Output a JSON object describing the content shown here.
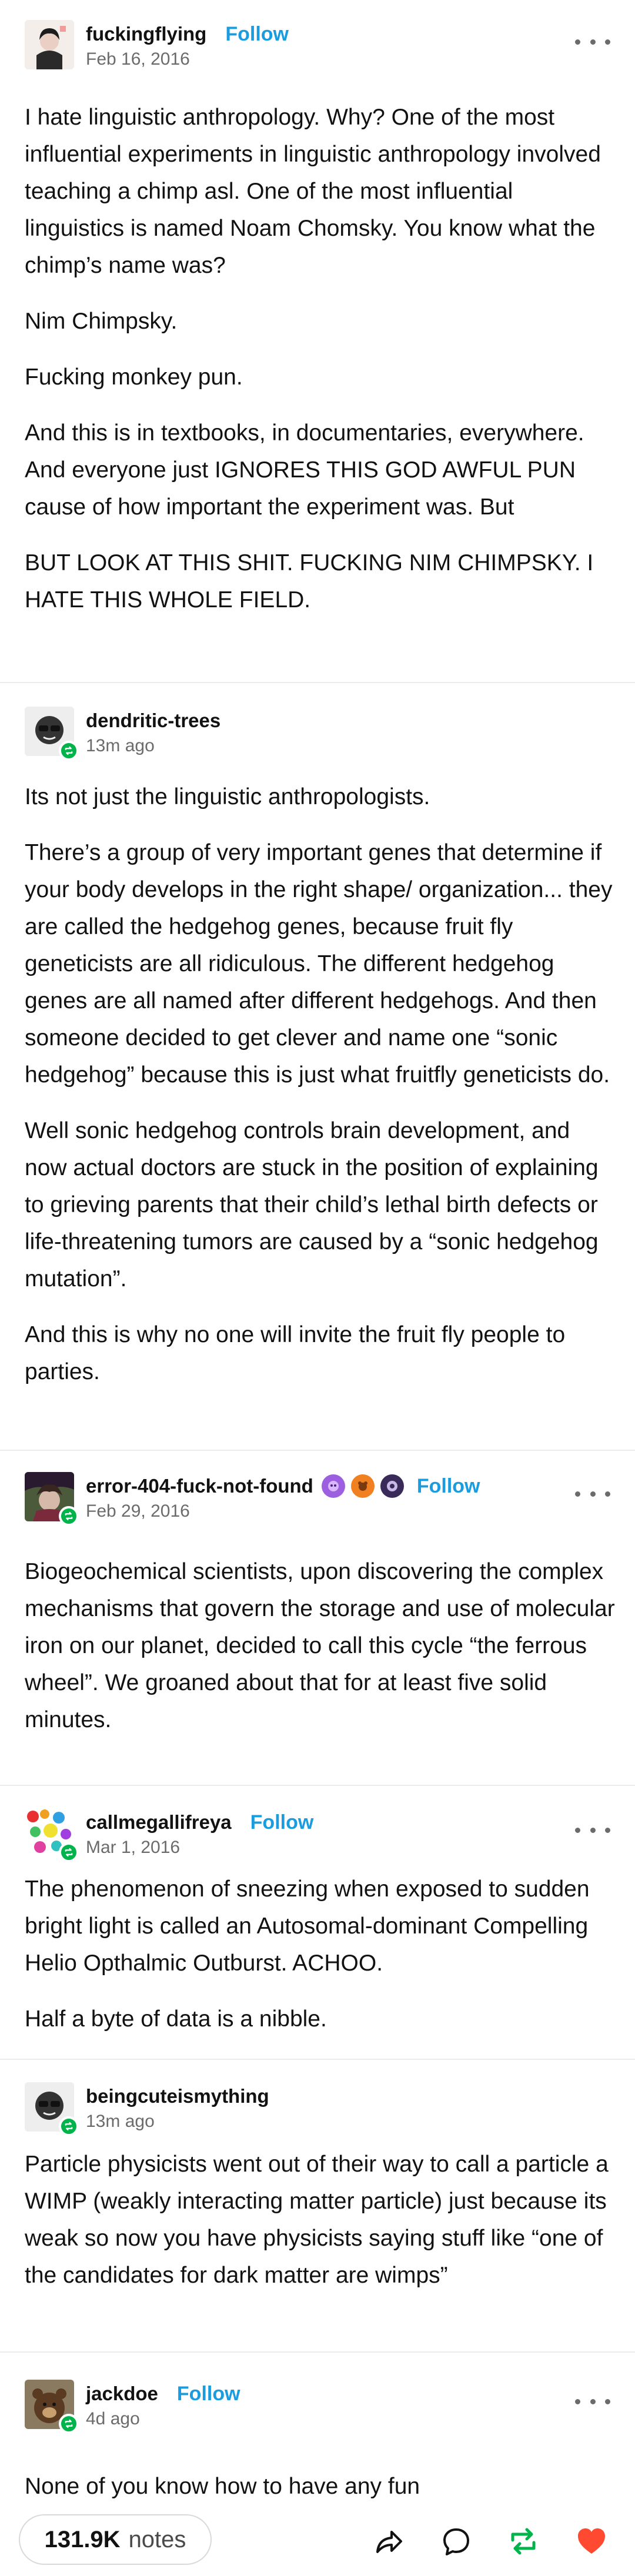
{
  "posts": [
    {
      "username": "fuckingflying",
      "follow_label": "Follow",
      "date": "Feb 16, 2016",
      "paragraphs": [
        "I hate linguistic anthropology. Why? One of the most influential experiments in linguistic anthropology involved teaching a chimp asl. One of the most influential linguistics is named Noam Chomsky. You know what the chimp’s name was?",
        "Nim Chimpsky.",
        "Fucking monkey pun.",
        "And this is in textbooks, in documentaries, everywhere. And everyone just IGNORES THIS GOD AWFUL PUN cause of how important the experiment was. But",
        "BUT LOOK AT THIS SHIT. FUCKING NIM CHIMPSKY. I HATE THIS WHOLE FIELD."
      ]
    },
    {
      "username": "dendritic-trees",
      "date": "13m ago",
      "paragraphs": [
        "Its not just the linguistic anthropologists.",
        "There’s a group of very important genes that determine if your body develops in the right shape/ organization... they are called the hedgehog genes, because fruit fly geneticists are all ridiculous.  The different hedgehog genes are all named after different hedgehogs.  And then someone decided to get clever and name one “sonic hedgehog” because this is just what fruitfly geneticists do.",
        "Well sonic hedgehog controls brain development, and now actual doctors are stuck in the position of explaining to grieving parents that their child’s lethal birth defects or life-threatening tumors are caused by a “sonic hedgehog mutation”.",
        "And this is why no one will invite the fruit fly people to parties."
      ]
    },
    {
      "username": "error-404-fuck-not-found",
      "follow_label": "Follow",
      "date": "Feb 29, 2016",
      "paragraphs": [
        "Biogeochemical scientists, upon discovering the complex mechanisms that govern the storage and use of molecular iron on our planet, decided to call this cycle “the ferrous wheel”.  We groaned about that for at least five solid minutes."
      ]
    },
    {
      "username": "callmegallifreya",
      "follow_label": "Follow",
      "date": "Mar 1, 2016",
      "paragraphs": [
        "The phenomenon of sneezing when exposed to sudden bright light is called an Autosomal-dominant Compelling Helio Opthalmic Outburst. ACHOO.",
        "Half a byte of data is a nibble."
      ]
    },
    {
      "username": "beingcuteismything",
      "date": "13m ago",
      "paragraphs": [
        "Particle physicists went out of their way to call a particle a WIMP (weakly interacting matter particle) just because its weak so now you have physicists saying stuff like “one of the candidates for dark matter are wimps”"
      ]
    },
    {
      "username": "jackdoe",
      "follow_label": "Follow",
      "date": "4d ago",
      "paragraphs": [
        "None of you know how to have any fun"
      ]
    }
  ],
  "footer": {
    "notes_count": "131.9K",
    "notes_label": "notes",
    "icons": [
      "share-icon",
      "reply-icon",
      "reblog-icon",
      "like-icon"
    ]
  },
  "colors": {
    "follow_blue": "#1a9cde",
    "reblog_green": "#00b34a",
    "like_red": "#ff4930",
    "divider": "#ebebeb"
  }
}
